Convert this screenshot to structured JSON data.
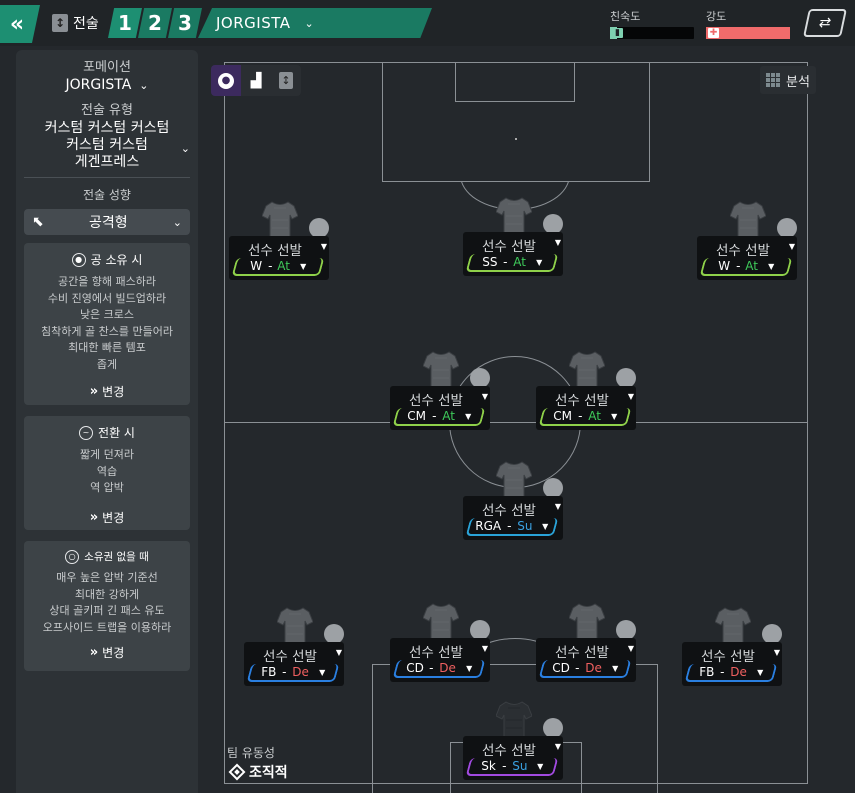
{
  "topbar": {
    "tactics_label": "전술",
    "slots": [
      "1",
      "2",
      "3"
    ],
    "tactic_name": "JORGISTA",
    "familiarity_label": "친숙도",
    "familiarity_value": 0.08,
    "intensity_label": "강도",
    "intensity_value": 1.0,
    "familiarity_color": "#7ed0b0",
    "intensity_color": "#f06b6b"
  },
  "sidebar": {
    "formation_label": "포메이션",
    "formation_value": "JORGISTA",
    "style_label": "전술 유형",
    "style_line1": "커스텀 커스텀 커스텀",
    "style_line2": "커스텀 커스텀",
    "style_line3": "게겐프레스",
    "mentality_label": "전술 성향",
    "mentality_value": "공격형",
    "in_possession": {
      "title": "공 소유 시",
      "lines": [
        "공간을 향해 패스하라",
        "수비 진영에서 빌드업하라",
        "낮은 크로스",
        "침착하게 골 찬스를 만들어라",
        "최대한 빠른 템포",
        "좁게"
      ],
      "change": "변경"
    },
    "in_transition": {
      "title": "전환 시",
      "lines": [
        "짧게 던져라",
        "역습",
        "역 압박"
      ],
      "change": "변경"
    },
    "out_of_possession": {
      "title": "소유권 없을 때",
      "lines": [
        "매우 높은 압박 기준선",
        "최대한 강하게",
        "상대 골키퍼 긴 패스 유도",
        "오프사이드 트랩을 이용하라"
      ],
      "change": "변경"
    }
  },
  "pitch": {
    "analysis_label": "분석",
    "fluidity_label": "팀 유동성",
    "fluidity_value": "조직적",
    "players": [
      {
        "name": "선수 선발",
        "pos": "W",
        "sep": " - ",
        "duty": "At",
        "duty_color": "#3ec95a",
        "line_color": "#8fd14a"
      },
      {
        "name": "선수 선발",
        "pos": "SS",
        "sep": " - ",
        "duty": "At",
        "duty_color": "#3ec95a",
        "line_color": "#8fd14a"
      },
      {
        "name": "선수 선발",
        "pos": "W",
        "sep": " - ",
        "duty": "At",
        "duty_color": "#3ec95a",
        "line_color": "#8fd14a"
      },
      {
        "name": "선수 선발",
        "pos": "CM",
        "sep": " - ",
        "duty": "At",
        "duty_color": "#3ec95a",
        "line_color": "#8fd14a"
      },
      {
        "name": "선수 선발",
        "pos": "CM",
        "sep": " - ",
        "duty": "At",
        "duty_color": "#3ec95a",
        "line_color": "#8fd14a"
      },
      {
        "name": "선수 선발",
        "pos": "RGA",
        "sep": " - ",
        "duty": "Su",
        "duty_color": "#3aa0e0",
        "line_color": "#2aa3d8"
      },
      {
        "name": "선수 선발",
        "pos": "FB",
        "sep": " - ",
        "duty": "De",
        "duty_color": "#f06060",
        "line_color": "#2a7fe0"
      },
      {
        "name": "선수 선발",
        "pos": "CD",
        "sep": " - ",
        "duty": "De",
        "duty_color": "#f06060",
        "line_color": "#2a7fe0"
      },
      {
        "name": "선수 선발",
        "pos": "CD",
        "sep": " - ",
        "duty": "De",
        "duty_color": "#f06060",
        "line_color": "#2a7fe0"
      },
      {
        "name": "선수 선발",
        "pos": "FB",
        "sep": " - ",
        "duty": "De",
        "duty_color": "#f06060",
        "line_color": "#2a7fe0"
      },
      {
        "name": "선수 선발",
        "pos": "Sk",
        "sep": " - ",
        "duty": "Su",
        "duty_color": "#3aa0e0",
        "line_color": "#a14ae0"
      }
    ]
  }
}
